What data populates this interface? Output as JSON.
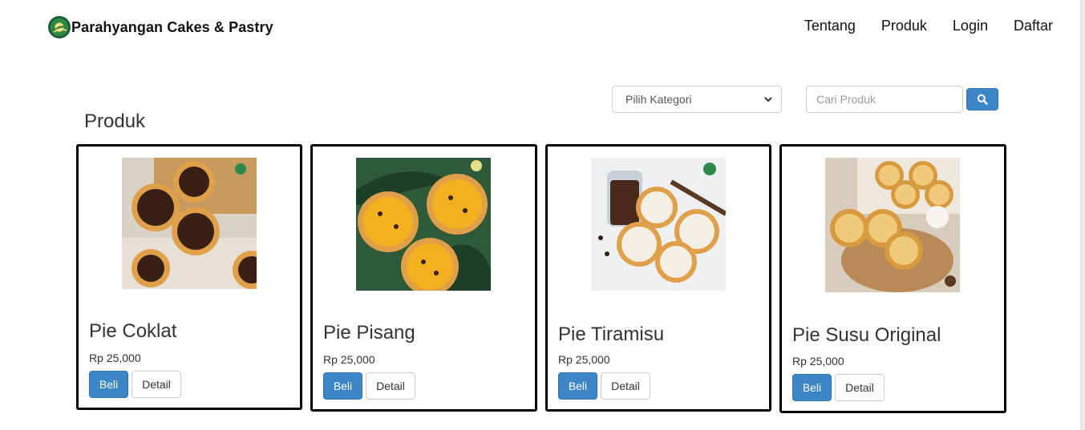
{
  "brand": {
    "name": "Parahyangan Cakes & Pastry",
    "logo_icon": "brand-logo-icon"
  },
  "nav": {
    "items": [
      "Tentang",
      "Produk",
      "Login",
      "Daftar"
    ]
  },
  "filters": {
    "category_selected": "Pilih Kategori",
    "search_placeholder": "Cari Produk",
    "search_icon": "search-icon"
  },
  "section": {
    "title": "Produk"
  },
  "products": [
    {
      "name": "Pie Coklat",
      "price": "Rp 25,000",
      "buy_label": "Beli",
      "detail_label": "Detail"
    },
    {
      "name": "Pie Pisang",
      "price": "Rp 25,000",
      "buy_label": "Beli",
      "detail_label": "Detail"
    },
    {
      "name": "Pie Tiramisu",
      "price": "Rp 25,000",
      "buy_label": "Beli",
      "detail_label": "Detail"
    },
    {
      "name": "Pie Susu Original",
      "price": "Rp 25,000",
      "buy_label": "Beli",
      "detail_label": "Detail"
    }
  ],
  "colors": {
    "primary_button": "#3c86c8",
    "card_border": "#000000"
  }
}
